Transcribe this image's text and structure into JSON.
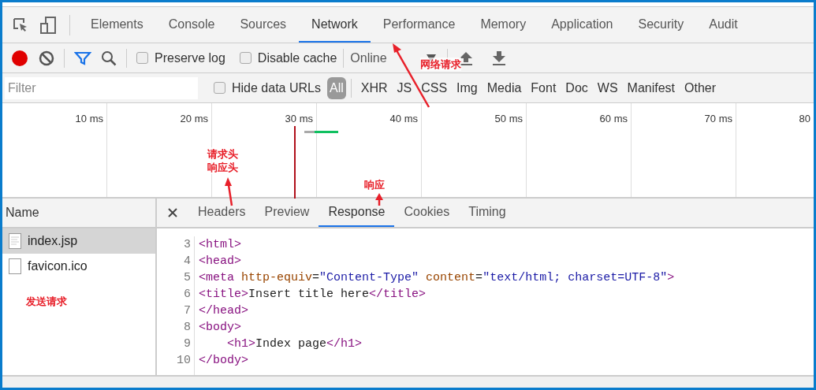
{
  "panel_tabs": [
    {
      "label": "Elements",
      "selected": false
    },
    {
      "label": "Console",
      "selected": false
    },
    {
      "label": "Sources",
      "selected": false
    },
    {
      "label": "Network",
      "selected": true
    },
    {
      "label": "Performance",
      "selected": false
    },
    {
      "label": "Memory",
      "selected": false
    },
    {
      "label": "Application",
      "selected": false
    },
    {
      "label": "Security",
      "selected": false
    },
    {
      "label": "Audit",
      "selected": false
    }
  ],
  "toolbar": {
    "recording": true,
    "preserve_log": {
      "label": "Preserve log",
      "checked": false
    },
    "disable_cache": {
      "label": "Disable cache",
      "checked": false
    },
    "throttling": "Online"
  },
  "filter": {
    "placeholder": "Filter",
    "hide_data_urls": {
      "label": "Hide data URLs",
      "checked": false
    },
    "types": [
      {
        "label": "All",
        "selected": true
      },
      {
        "label": "XHR",
        "selected": false
      },
      {
        "label": "JS",
        "selected": false
      },
      {
        "label": "CSS",
        "selected": false
      },
      {
        "label": "Img",
        "selected": false
      },
      {
        "label": "Media",
        "selected": false
      },
      {
        "label": "Font",
        "selected": false
      },
      {
        "label": "Doc",
        "selected": false
      },
      {
        "label": "WS",
        "selected": false
      },
      {
        "label": "Manifest",
        "selected": false
      },
      {
        "label": "Other",
        "selected": false
      }
    ]
  },
  "timeline": {
    "ticks": [
      "10 ms",
      "20 ms",
      "30 ms",
      "40 ms",
      "50 ms",
      "60 ms",
      "70 ms",
      "80"
    ]
  },
  "requests": {
    "column": "Name",
    "items": [
      {
        "name": "index.jsp",
        "kind": "document",
        "selected": true
      },
      {
        "name": "favicon.ico",
        "kind": "blank",
        "selected": false
      }
    ]
  },
  "detail": {
    "tabs": [
      {
        "label": "Headers",
        "selected": false
      },
      {
        "label": "Preview",
        "selected": false
      },
      {
        "label": "Response",
        "selected": true
      },
      {
        "label": "Cookies",
        "selected": false
      },
      {
        "label": "Timing",
        "selected": false
      }
    ],
    "lines": [
      {
        "number": "3",
        "indent": false,
        "tokens": [
          {
            "kind": "tag",
            "text": "<html>"
          }
        ]
      },
      {
        "number": "4",
        "indent": false,
        "tokens": [
          {
            "kind": "tag",
            "text": "<head>"
          }
        ]
      },
      {
        "number": "5",
        "indent": false,
        "tokens": [
          {
            "kind": "tag",
            "text": "<meta"
          },
          {
            "kind": "attr",
            "text": " http-equiv"
          },
          {
            "kind": "plain",
            "text": "="
          },
          {
            "kind": "value",
            "text": "\"Content-Type\""
          },
          {
            "kind": "attr",
            "text": " content"
          },
          {
            "kind": "plain",
            "text": "="
          },
          {
            "kind": "value",
            "text": "\"text/html; charset=UTF-8\""
          },
          {
            "kind": "tag",
            "text": ">"
          }
        ]
      },
      {
        "number": "6",
        "indent": false,
        "tokens": [
          {
            "kind": "tag",
            "text": "<title>"
          },
          {
            "kind": "plain",
            "text": "Insert title here"
          },
          {
            "kind": "tag",
            "text": "</title>"
          }
        ]
      },
      {
        "number": "7",
        "indent": false,
        "tokens": [
          {
            "kind": "tag",
            "text": "</head>"
          }
        ]
      },
      {
        "number": "8",
        "indent": false,
        "tokens": [
          {
            "kind": "tag",
            "text": "<body>"
          }
        ]
      },
      {
        "number": "9",
        "indent": true,
        "tokens": [
          {
            "kind": "tag",
            "text": "<h1>"
          },
          {
            "kind": "plain",
            "text": "Index page"
          },
          {
            "kind": "tag",
            "text": "</h1>"
          }
        ]
      },
      {
        "number": "10",
        "indent": false,
        "tokens": [
          {
            "kind": "tag",
            "text": "</body>"
          }
        ]
      }
    ]
  },
  "annotations": [
    {
      "kind": "network",
      "lines": [
        "网络请求"
      ]
    },
    {
      "kind": "headers",
      "lines": [
        "请求头",
        "响应头"
      ]
    },
    {
      "kind": "response",
      "lines": [
        "响应"
      ]
    },
    {
      "kind": "send",
      "lines": [
        "发送请求"
      ]
    }
  ]
}
